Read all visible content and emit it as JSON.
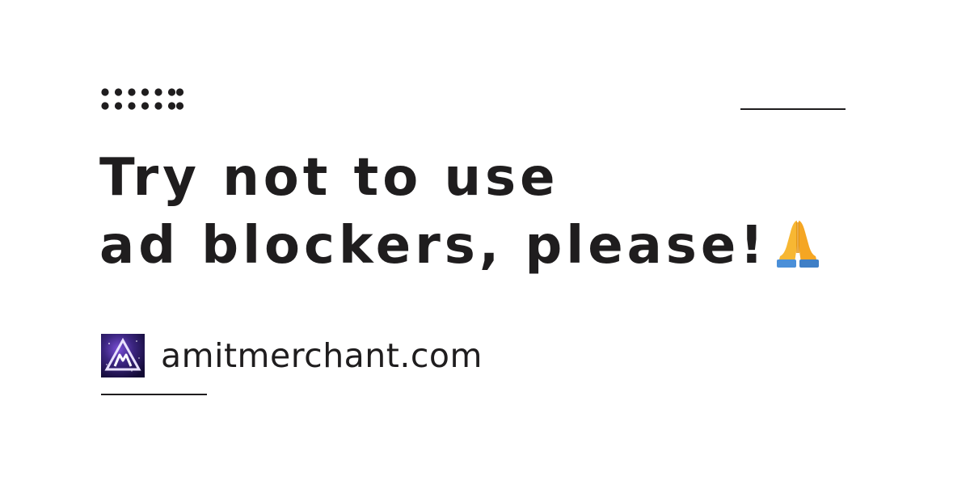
{
  "headline": {
    "line1": "Try not to use",
    "line2": "ad blockers, please!"
  },
  "emoji": {
    "icon": "folded-hands-emoji"
  },
  "brand": {
    "site": "amitmerchant.com",
    "logo_icon": "mountain-triangle-logo",
    "logo_letter": "M"
  },
  "colors": {
    "text": "#1f1d1e",
    "background": "#ffffff",
    "logo_bg": "#2b1a5c",
    "logo_accent": "#c8b8ff",
    "emoji_skin": "#f7b733",
    "emoji_sleeve": "#4a8fd8"
  }
}
